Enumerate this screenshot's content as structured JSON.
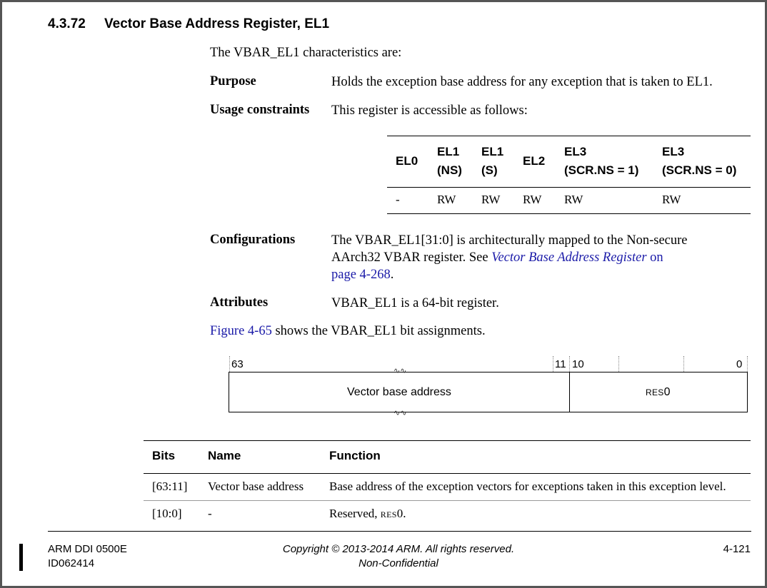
{
  "section": {
    "number": "4.3.72",
    "title": "Vector Base Address Register, EL1"
  },
  "intro": "The VBAR_EL1 characteristics are:",
  "purpose": {
    "term": "Purpose",
    "text": "Holds the exception base address for any exception that is taken to EL1."
  },
  "usage": {
    "term": "Usage constraints",
    "text": "This register is accessible as follows:"
  },
  "access_table": {
    "headers": [
      {
        "line1": "EL0",
        "line2": ""
      },
      {
        "line1": "EL1",
        "line2": "(NS)"
      },
      {
        "line1": "EL1",
        "line2": "(S)"
      },
      {
        "line1": "EL2",
        "line2": ""
      },
      {
        "line1": "EL3",
        "line2": "(SCR.NS = 1)"
      },
      {
        "line1": "EL3",
        "line2": "(SCR.NS = 0)"
      }
    ],
    "values": [
      "-",
      "RW",
      "RW",
      "RW",
      "RW",
      "RW"
    ]
  },
  "configurations": {
    "term": "Configurations",
    "text_part1": "The VBAR_EL1[31:0] is architecturally mapped to the Non-secure",
    "text_part2": "AArch32 VBAR register. See ",
    "link_title": "Vector Base Address Register",
    "link_on": " on",
    "link_page": "page 4-268",
    "text_end": "."
  },
  "attributes": {
    "term": "Attributes",
    "text": "VBAR_EL1 is a 64-bit register."
  },
  "figure_ref": {
    "link": "Figure 4-65",
    "text": " shows the VBAR_EL1 bit assignments."
  },
  "bit_diagram": {
    "labels": {
      "b63": "63",
      "b11": "11",
      "b10": "10",
      "b0": "0"
    },
    "break_mark": "∿∿",
    "field_high": "Vector base address",
    "field_low_prefix": "RES",
    "field_low_suffix": "0"
  },
  "bits_table": {
    "headers": {
      "bits": "Bits",
      "name": "Name",
      "function": "Function"
    },
    "rows": [
      {
        "bits": "[63:11]",
        "name": "Vector base address",
        "function": "Base address of the exception vectors for exceptions taken in this exception level."
      },
      {
        "bits": "[10:0]",
        "name": "-",
        "function_prefix": "Reserved, ",
        "function_sc": "RES",
        "function_suffix": "0."
      }
    ]
  },
  "footer": {
    "doc_id": "ARM DDI 0500E",
    "doc_version": "ID062414",
    "copyright": "Copyright © 2013-2014 ARM. All rights reserved.",
    "confidentiality": "Non-Confidential",
    "page_number": "4-121"
  }
}
